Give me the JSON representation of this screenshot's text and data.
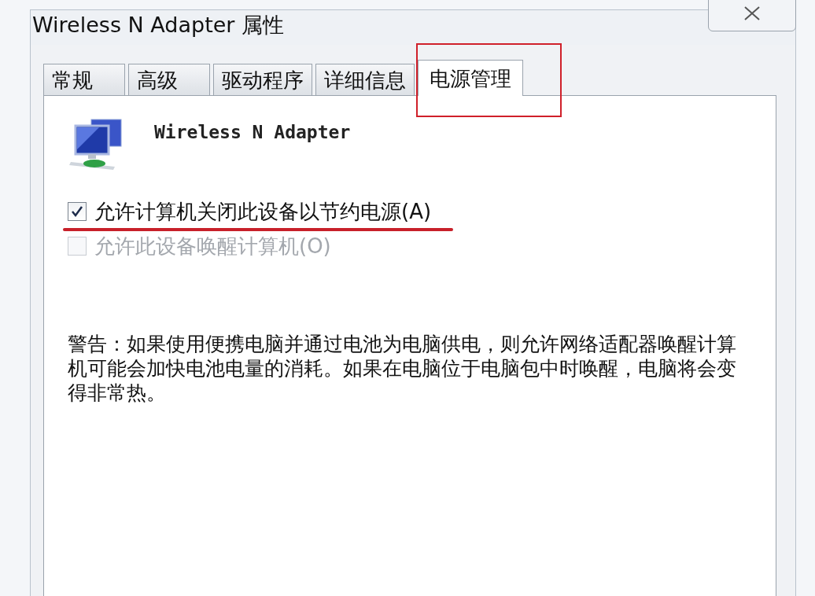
{
  "window": {
    "title": "Wireless N Adapter 属性"
  },
  "tabs": [
    {
      "label": "常规",
      "selected": false
    },
    {
      "label": "高级",
      "selected": false
    },
    {
      "label": "驱动程序",
      "selected": false
    },
    {
      "label": "详细信息",
      "selected": false
    },
    {
      "label": "电源管理",
      "selected": true
    }
  ],
  "device": {
    "name": "Wireless N Adapter"
  },
  "options": [
    {
      "label": "允许计算机关闭此设备以节约电源(A)",
      "checked": true,
      "disabled": false
    },
    {
      "label": "允许此设备唤醒计算机(O)",
      "checked": false,
      "disabled": true
    }
  ],
  "warning": "警告：如果使用便携电脑并通过电池为电脑供电，则允许网络适配器唤醒计算机可能会加快电池电量的消耗。如果在电脑位于电脑包中时唤醒，电脑将会变得非常热。"
}
